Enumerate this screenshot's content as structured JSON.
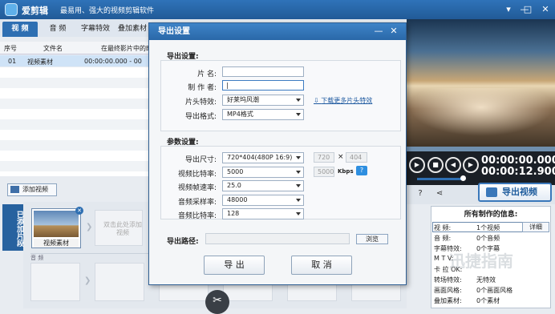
{
  "app": {
    "name": "爱剪辑",
    "slogan": "最易用、强大的视频剪辑软件"
  },
  "window_controls": {
    "menu": "▾",
    "minimize": "—",
    "maximize": "□",
    "close": "✕"
  },
  "tabs": [
    {
      "label": "视 频",
      "active": true
    },
    {
      "label": "音 频",
      "active": false
    },
    {
      "label": "字幕特效",
      "active": false
    },
    {
      "label": "叠加素材",
      "active": false
    }
  ],
  "clip_table": {
    "headers": [
      "序号",
      "文件名",
      "在最终影片中的时"
    ],
    "rows": [
      {
        "index": "01",
        "name": "视频素材",
        "time": "00:00:00.000 - 00"
      }
    ]
  },
  "add_video_label": "添加视频",
  "side_tab_label": "已添加片段",
  "timeline": {
    "clip_name": "视频素材",
    "placeholder": "双击此处添加视频",
    "audio_label": "音 频"
  },
  "player": {
    "current_time": "00:00:00.000",
    "total_time": "00:00:12.900"
  },
  "export_button_label": "导出视频",
  "info_panel": {
    "title": "所有制作的信息:",
    "detail_button": "详细",
    "rows": [
      {
        "key": "视    频:",
        "value": "1个视频"
      },
      {
        "key": "音    频:",
        "value": "0个音频"
      },
      {
        "key": "字幕特效:",
        "value": "0个字幕"
      },
      {
        "key": "M  T  V:",
        "value": ""
      },
      {
        "key": "卡 拉 OK:",
        "value": ""
      },
      {
        "key": "转场特效:",
        "value": "无特效"
      },
      {
        "key": "画面风格:",
        "value": "0个画面风格"
      },
      {
        "key": "叠加素材:",
        "value": "0个素材"
      }
    ]
  },
  "watermark": "迅捷指南",
  "dialog": {
    "title": "导出设置",
    "export_settings_heading": "导出设置:",
    "film_name_label": "片    名:",
    "film_name_value": "",
    "author_label": "制 作 者:",
    "author_value": "|",
    "intro_effect_label": "片头特效:",
    "intro_effect_value": "好莱坞风潮",
    "download_link": "下载更多片头特效",
    "format_label": "导出格式:",
    "format_value": "MP4格式",
    "param_heading": "参数设置:",
    "size_label": "导出尺寸:",
    "size_value": "720*404(480P 16:9)",
    "width_value": "720",
    "times_sign": "×",
    "height_value": "404",
    "vbitrate_label": "视频比特率:",
    "vbitrate_value": "5000",
    "vbitrate_custom": "5000",
    "kbps_label": "Kbps",
    "help_label": "?",
    "framerate_label": "视频帧速率:",
    "framerate_value": "25.0",
    "samplerate_label": "音频采样率:",
    "samplerate_value": "48000",
    "abitrate_label": "音频比特率:",
    "abitrate_value": "128",
    "path_label": "导出路径:",
    "path_value": "",
    "browse_label": "浏览",
    "export_label": "导 出",
    "cancel_label": "取 消"
  },
  "colors": {
    "accent": "#2e6fb2",
    "titlebar": "#2a62a3"
  }
}
